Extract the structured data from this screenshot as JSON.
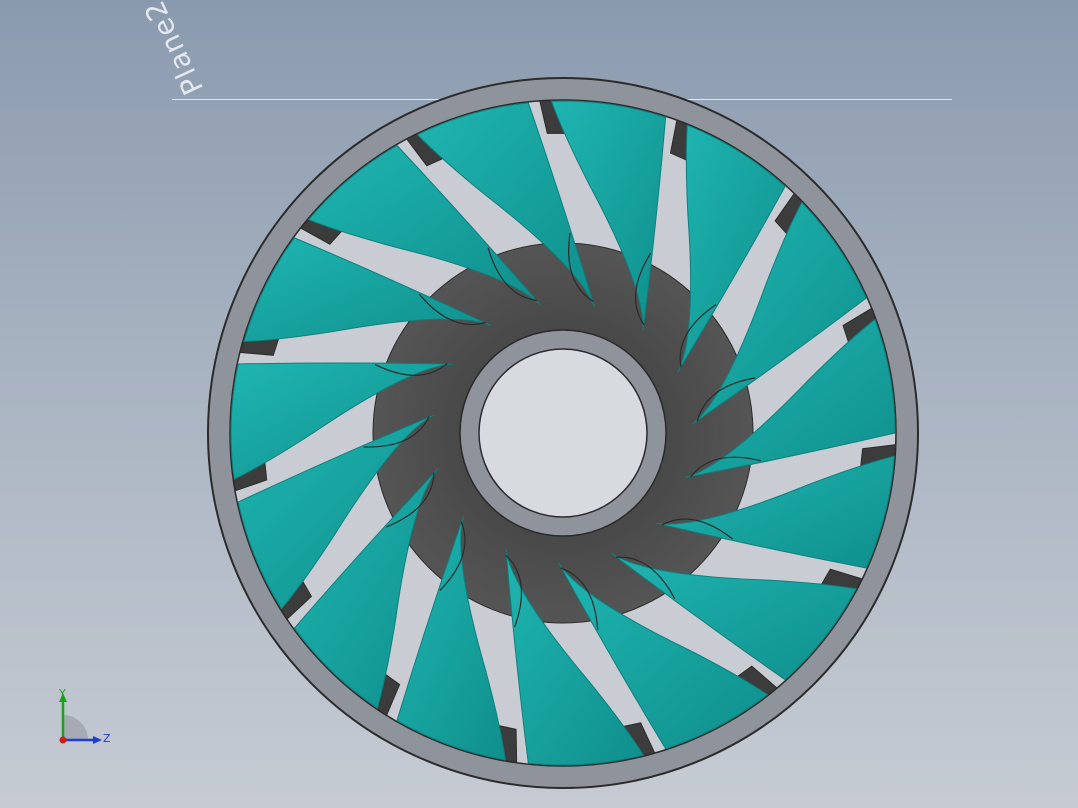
{
  "viewport": {
    "plane_label": "Plane2",
    "colors": {
      "background_top": "#8a9aae",
      "background_bottom": "#c6cbd3",
      "blade": "#1aa7a4",
      "blade_dark": "#0e7f7d",
      "hub": "#444444",
      "ring": "#8f939b",
      "ring_edge": "#2b2b2b"
    },
    "model": {
      "name": "turbine-runner",
      "blade_count": 15,
      "opening_count": 15
    }
  },
  "triad": {
    "y_label": "Y",
    "z_label": "Z",
    "y_color": "#1aa31a",
    "z_color": "#1f3bd6",
    "x_color": "#d11a1a"
  }
}
